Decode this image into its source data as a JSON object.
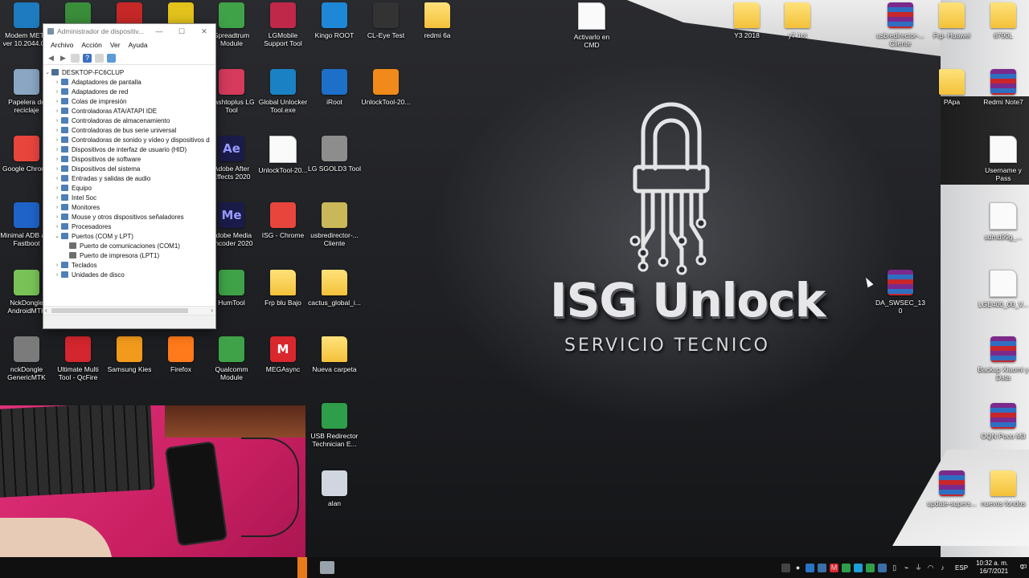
{
  "wallpaper": {
    "brand_title": "ISG Unlock",
    "brand_subtitle": "SERVICIO TECNICO"
  },
  "desktop_icons": [
    {
      "label": "Modem META ver 10.2044.0...",
      "icon": "modem-meta-icon",
      "color": "#1e7bbf"
    },
    {
      "label": "Papelera de reciclaje",
      "icon": "recycle-bin-icon",
      "color": "#8aa6c2"
    },
    {
      "label": "Google Chrome",
      "icon": "chrome-icon",
      "color": "#e8453c"
    },
    {
      "label": "Minimal ADB and Fastboot",
      "icon": "adb-icon",
      "color": "#1f63c8"
    },
    {
      "label": "NckDongle AndroidMTK",
      "icon": "android-icon",
      "color": "#78c257"
    },
    {
      "label": "nckDongle GenericMTK",
      "icon": "dongle-icon",
      "color": "#7b7b7b"
    },
    {
      "label": "",
      "icon": "app-icon",
      "color": "#3a8e3a"
    },
    {
      "label": "Ultimate Multi Tool - QcFire",
      "icon": "umt-icon",
      "color": "#d3262e"
    },
    {
      "label": "",
      "icon": "efta-icon",
      "color": "#c62828"
    },
    {
      "label": "Samsung Kies",
      "icon": "kies-icon",
      "color": "#f29a1c"
    },
    {
      "label": "",
      "icon": "app-icon",
      "color": "#e2c21b"
    },
    {
      "label": "Firefox",
      "icon": "firefox-icon",
      "color": "#ff7a1a"
    },
    {
      "label": "Spreadtrum Module",
      "icon": "spreadtrum-icon",
      "color": "#3fa248"
    },
    {
      "label": "Flashtoplus LG Tool",
      "icon": "lg-tool-icon",
      "color": "#d63a5c"
    },
    {
      "label": "Adobe After Effects 2020",
      "icon": "after-effects-icon",
      "color": "#1b1b4a",
      "glyph": "Ae",
      "glyph_color": "#9a9cff"
    },
    {
      "label": "Adobe Media Encoder 2020",
      "icon": "media-encoder-icon",
      "color": "#1b1b4a",
      "glyph": "Me",
      "glyph_color": "#9a9cff"
    },
    {
      "label": "HumTool",
      "icon": "humtool-icon",
      "color": "#3fa248"
    },
    {
      "label": "Qualcomm Module",
      "icon": "qualcomm-icon",
      "color": "#3fa248"
    },
    {
      "label": "LGMobile Support Tool",
      "icon": "lgmobile-icon",
      "color": "#c0284a"
    },
    {
      "label": "Global Unlocker Tool.exe",
      "icon": "global-unlocker-icon",
      "color": "#1a82c4"
    },
    {
      "label": "UnlockTool-20...",
      "icon": "file-icon",
      "color": "#fafafa",
      "kind": "file"
    },
    {
      "label": "ISG - Chrome",
      "icon": "chrome-icon",
      "color": "#e8453c"
    },
    {
      "label": "Frp blu Bajo",
      "icon": "zip-folder-icon",
      "color": "#f3c13a",
      "kind": "folder"
    },
    {
      "label": "MEGAsync",
      "icon": "mega-icon",
      "color": "#d9272e",
      "glyph": "M"
    },
    {
      "label": "Kingo ROOT",
      "icon": "kingo-root-icon",
      "color": "#1e88d6"
    },
    {
      "label": "iRoot",
      "icon": "iroot-icon",
      "color": "#1e6fc8"
    },
    {
      "label": "LG SGOLD3 Tool",
      "icon": "lg-sgold-icon",
      "color": "#8d8d8d"
    },
    {
      "label": "usbredirector-... Cliente",
      "icon": "usbredirector-icon",
      "color": "#c9b85a"
    },
    {
      "label": "cactus_global_i...",
      "icon": "zip-folder-icon",
      "color": "#f3c13a",
      "kind": "folder"
    },
    {
      "label": "Nueva carpeta",
      "icon": "folder-icon",
      "color": "#f3c13a",
      "kind": "folder"
    },
    {
      "label": "USB Redirector Technician E...",
      "icon": "usb-redirector-tech-icon",
      "color": "#2e9e4a"
    },
    {
      "label": "alan",
      "icon": "image-file-icon",
      "color": "#cfd6df"
    },
    {
      "label": "CL-Eye Test",
      "icon": "webcam-icon",
      "color": "#333333"
    },
    {
      "label": "UnlockTool-20...",
      "icon": "unlocktool-icon",
      "color": "#f08a1a"
    },
    {
      "label": "redmi 6a",
      "icon": "folder-icon",
      "color": "#f3c13a",
      "kind": "folder"
    },
    {
      "label": "Activarlo en CMD",
      "icon": "text-file-icon",
      "color": "#fafafa",
      "kind": "file"
    },
    {
      "label": "Y3 2018",
      "icon": "zip-folder-icon",
      "color": "#f3c13a",
      "kind": "folder"
    },
    {
      "label": "y7 1ot",
      "icon": "folder-icon",
      "color": "#f3c13a",
      "kind": "folder"
    },
    {
      "label": "usbredirector-... Cliente",
      "icon": "winrar-icon",
      "color": "#7b2a8c",
      "kind": "winrar"
    },
    {
      "label": "Frp- Huawei",
      "icon": "folder-icon",
      "color": "#f3c13a",
      "kind": "folder"
    },
    {
      "label": "6790L",
      "icon": "folder-icon",
      "color": "#f3c13a",
      "kind": "folder"
    },
    {
      "label": "PApa",
      "icon": "folder-icon",
      "color": "#f3c13a",
      "kind": "folder"
    },
    {
      "label": "Redmi Note7",
      "icon": "winrar-icon",
      "color": "#7b2a8c",
      "kind": "winrar"
    },
    {
      "label": "Username y Pass",
      "icon": "text-file-icon",
      "color": "#fafafa",
      "kind": "file"
    },
    {
      "label": "sdmd99g_...",
      "icon": "file-icon",
      "color": "#fafafa",
      "kind": "file"
    },
    {
      "label": "DA_SWSEC_130",
      "icon": "winrar-icon",
      "color": "#7b2a8c",
      "kind": "winrar"
    },
    {
      "label": "LGE400_00_V...",
      "icon": "file-icon",
      "color": "#fafafa",
      "kind": "file"
    },
    {
      "label": "Backup Xiaomi y Data",
      "icon": "winrar-icon",
      "color": "#7b2a8c",
      "kind": "winrar"
    },
    {
      "label": "OQN Poco M3",
      "icon": "winrar-icon",
      "color": "#7b2a8c",
      "kind": "winrar"
    },
    {
      "label": "update-supers...",
      "icon": "winrar-icon",
      "color": "#7b2a8c",
      "kind": "winrar"
    },
    {
      "label": "nuevos fondos",
      "icon": "zip-folder-icon",
      "color": "#f3c13a",
      "kind": "folder"
    }
  ],
  "device_manager": {
    "title": "Administrador de dispositiv...",
    "controls": [
      "—",
      "☐",
      "✕"
    ],
    "menu": [
      "Archivo",
      "Acción",
      "Ver",
      "Ayuda"
    ],
    "tree_root": "DESKTOP-FC6CLUP",
    "tree": [
      {
        "label": "Adaptadores de pantalla",
        "expanded": false
      },
      {
        "label": "Adaptadores de red",
        "expanded": false
      },
      {
        "label": "Colas de impresión",
        "expanded": false
      },
      {
        "label": "Controladoras ATA/ATAPI IDE",
        "expanded": false
      },
      {
        "label": "Controladoras de almacenamiento",
        "expanded": false
      },
      {
        "label": "Controladoras de bus serie universal",
        "expanded": false
      },
      {
        "label": "Controladoras de sonido y vídeo y dispositivos d",
        "expanded": false
      },
      {
        "label": "Dispositivos de interfaz de usuario (HID)",
        "expanded": false
      },
      {
        "label": "Dispositivos de software",
        "expanded": false
      },
      {
        "label": "Dispositivos del sistema",
        "expanded": false
      },
      {
        "label": "Entradas y salidas de audio",
        "expanded": false
      },
      {
        "label": "Equipo",
        "expanded": false
      },
      {
        "label": "Intel Soc",
        "expanded": false
      },
      {
        "label": "Monitores",
        "expanded": false
      },
      {
        "label": "Mouse y otros dispositivos señaladores",
        "expanded": false
      },
      {
        "label": "Procesadores",
        "expanded": false
      },
      {
        "label": "Puertos (COM y LPT)",
        "expanded": true,
        "children": [
          "Puerto de comunicaciones (COM1)",
          "Puerto de impresora (LPT1)"
        ]
      },
      {
        "label": "Teclados",
        "expanded": false
      },
      {
        "label": "Unidades de disco",
        "expanded": false
      }
    ]
  },
  "taskbar": {
    "language": "ESP",
    "time": "10:32 a. m.",
    "date": "16/7/2021",
    "notification_count": "2"
  }
}
